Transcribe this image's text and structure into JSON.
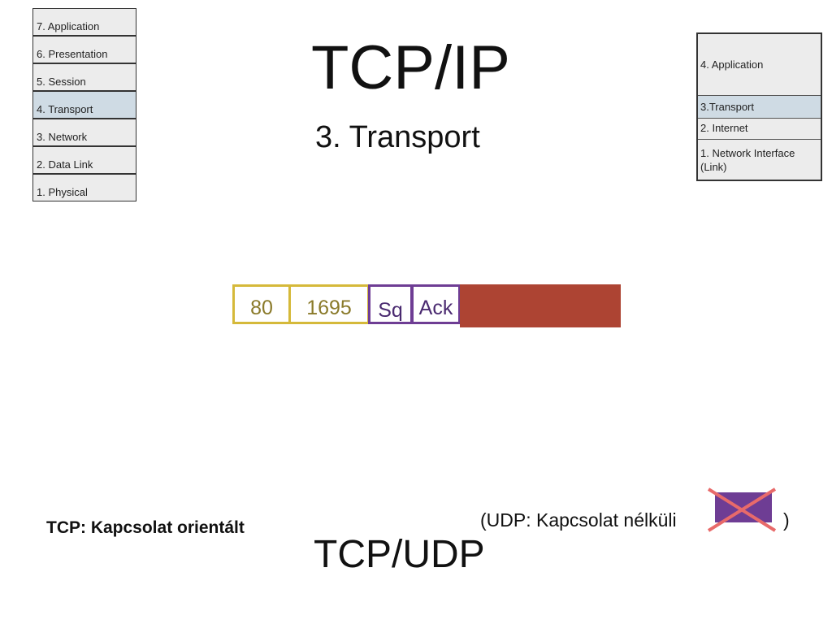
{
  "osi_layers": [
    "7. Application",
    "6. Presentation",
    "5. Session",
    "4. Transport",
    "3. Network",
    "2. Data Link",
    "1. Physical"
  ],
  "title": "TCP/IP",
  "subtitle": "3. Transport",
  "tcpip_layers": [
    "4. Application",
    "3.Transport",
    "2. Internet",
    "1. Network Interface (Link)"
  ],
  "segment": {
    "src_port": "80",
    "dst_port": "1695",
    "seq": "Sq",
    "ack": "Ack"
  },
  "colors": {
    "port": "#d5b93a",
    "flags": "#6e3d94",
    "payload": "#ad4433",
    "highlight": "#cfdbe4",
    "cross": "#e86a6a"
  },
  "tcp_note": "TCP: Kapcsolat orientált",
  "protocols": "TCP/UDP",
  "udp_note": "(UDP: Kapcsolat nélküli",
  "udp_close": ")"
}
